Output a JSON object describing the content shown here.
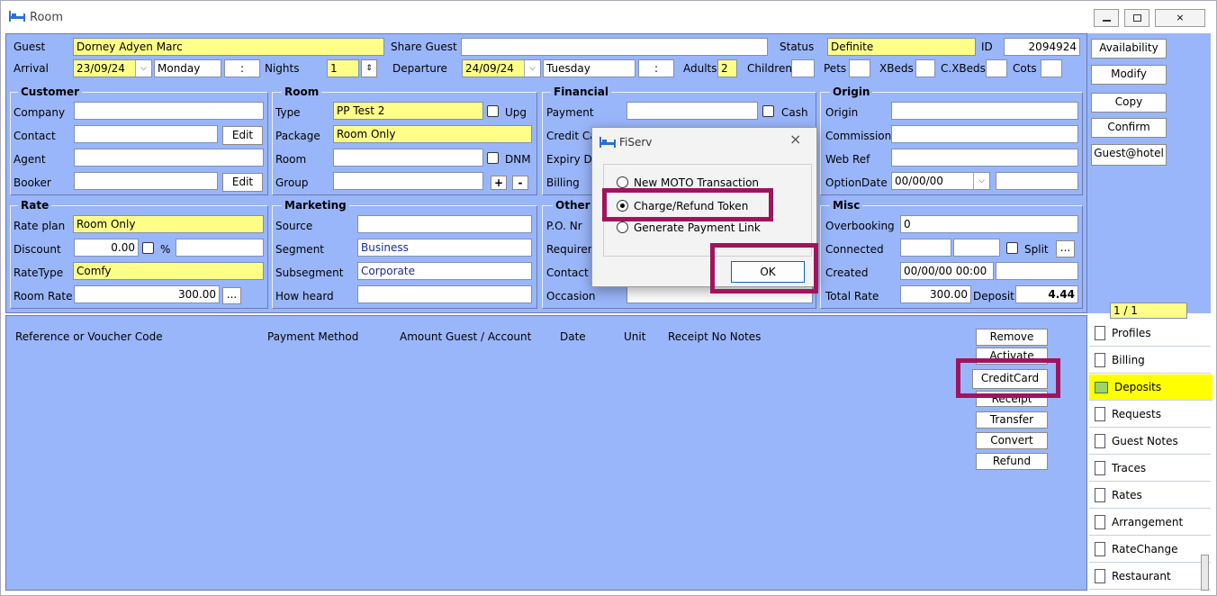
{
  "window": {
    "title": "Room",
    "icon": "bed-icon",
    "controls": [
      "minimize-icon",
      "restore-icon",
      "close-icon"
    ]
  },
  "row1": {
    "guest_label": "Guest",
    "guest_value": "Dorney Adyen Marc",
    "share_label": "Share Guest",
    "share_value": "",
    "status_label": "Status",
    "status_value": "Definite",
    "id_label": "ID",
    "id_value": "2094924"
  },
  "row2": {
    "arrival_label": "Arrival",
    "arrival_date": "23/09/24",
    "arrival_day": "Monday",
    "arrival_time": ":",
    "nights_label": "Nights",
    "nights_value": "1",
    "departure_label": "Departure",
    "departure_date": "24/09/24",
    "departure_day": "Tuesday",
    "departure_time": ":",
    "adults_label": "Adults",
    "adults_value": "2",
    "children_label": "Children",
    "pets_label": "Pets",
    "xbeds_label": "XBeds",
    "cxbeds_label": "C.XBeds",
    "cots_label": "Cots"
  },
  "customer": {
    "title": "Customer",
    "company_label": "Company",
    "contact_label": "Contact",
    "contact_edit": "Edit",
    "agent_label": "Agent",
    "booker_label": "Booker",
    "booker_edit": "Edit"
  },
  "room": {
    "title": "Room",
    "type_label": "Type",
    "type_value": "PP Test 2",
    "upg_label": "Upg",
    "package_label": "Package",
    "package_value": "Room Only",
    "room_label": "Room",
    "dnm_label": "DNM",
    "group_label": "Group",
    "plus": "+",
    "minus": "-"
  },
  "financial": {
    "title": "Financial",
    "payment_label": "Payment",
    "cash_label": "Cash",
    "credit_label": "Credit Ca",
    "expiry_label": "Expiry Da",
    "billing_label": "Billing"
  },
  "origin": {
    "title": "Origin",
    "origin_label": "Origin",
    "commission_label": "Commission",
    "webref_label": "Web Ref",
    "optiondate_label": "OptionDate",
    "optiondate_value": "00/00/00"
  },
  "rate": {
    "title": "Rate",
    "rateplan_label": "Rate plan",
    "rateplan_value": "Room Only",
    "discount_label": "Discount",
    "discount_value": "0.00",
    "pct": "%",
    "ratetype_label": "RateType",
    "ratetype_value": "Comfy",
    "roomrate_label": "Room Rate",
    "roomrate_value": "300.00",
    "ellipsis": "..."
  },
  "marketing": {
    "title": "Marketing",
    "source_label": "Source",
    "segment_label": "Segment",
    "segment_value": "Business",
    "subsegment_label": "Subsegment",
    "subsegment_value": "Corporate",
    "howheard_label": "How heard"
  },
  "other": {
    "title": "Other",
    "po_label": "P.O. Nr",
    "req_label": "Requiren",
    "contact_label": "Contact",
    "occasion_label": "Occasion"
  },
  "misc": {
    "title": "Misc",
    "overbooking_label": "Overbooking",
    "overbooking_value": "0",
    "connected_label": "Connected",
    "split_label": "Split",
    "ellipsis": "...",
    "created_label": "Created",
    "created_value": "00/00/00 00:00",
    "totalrate_label": "Total Rate",
    "totalrate_value": "300.00",
    "deposit_label": "Deposit",
    "deposit_value": "4.44"
  },
  "side_buttons": [
    "Availability",
    "Modify",
    "Copy",
    "Confirm",
    "Guest@hotel"
  ],
  "pager": "1 / 1",
  "deposits_headers": {
    "ref": "Reference or Voucher Code",
    "method": "Payment Method",
    "amount": "Amount Guest / Account",
    "date": "Date",
    "unit": "Unit",
    "receipt": "Receipt No Notes"
  },
  "deposit_buttons": [
    "Remove",
    "Activate",
    "CreditCard",
    "Receipt",
    "Transfer",
    "Convert",
    "Refund"
  ],
  "tabs": [
    "Profiles",
    "Billing",
    "Deposits",
    "Requests",
    "Guest Notes",
    "Traces",
    "Rates",
    "Arrangement",
    "RateChange",
    "Restaurant"
  ],
  "dialog": {
    "title": "FiServ",
    "close": "×",
    "options": [
      "New MOTO Transaction",
      "Charge/Refund Token",
      "Generate Payment Link"
    ],
    "selected": 1,
    "ok": "OK"
  },
  "colors": {
    "form_bg": "#9ab6fa",
    "required_field": "#ffff88",
    "highlight": "#a0145e",
    "selected_tab": "#ffff00"
  }
}
